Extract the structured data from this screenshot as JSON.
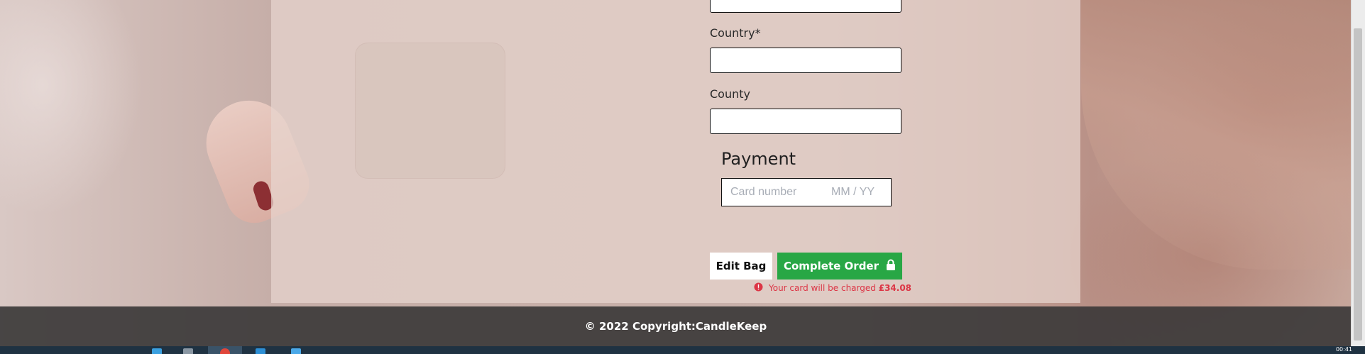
{
  "form": {
    "country_label": "Country*",
    "county_label": "County",
    "payment_title": "Payment",
    "card_number_placeholder": "Card number",
    "expiry_placeholder": "MM / YY"
  },
  "actions": {
    "edit_bag_label": "Edit Bag",
    "complete_order_label": "Complete Order",
    "charge_prefix": "Your card will be charged",
    "charge_amount": "£34.08"
  },
  "footer": {
    "copyright": "© 2022 Copyright:CandleKeep"
  },
  "taskbar": {
    "time": "00:41"
  },
  "colors": {
    "primary_button": "#28a745",
    "error_text": "#dc3545",
    "footer_bg": "#3c3a39"
  },
  "icons": {
    "complete_order": "lock-icon",
    "charge_notice": "exclamation-circle-icon"
  }
}
